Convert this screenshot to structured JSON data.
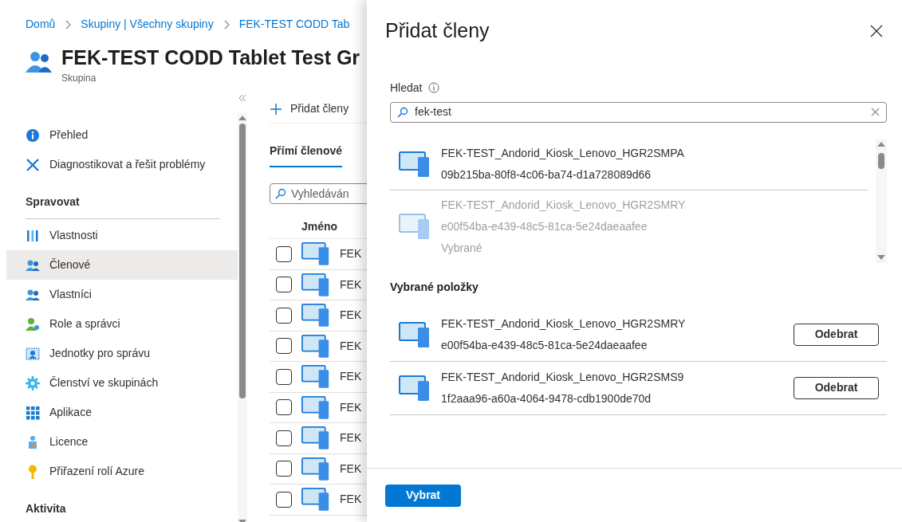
{
  "breadcrumb": [
    {
      "label": "Domů"
    },
    {
      "label": "Skupiny | Všechny skupiny"
    },
    {
      "label": "FEK-TEST CODD Tab"
    }
  ],
  "page": {
    "title": "FEK-TEST CODD Tablet Test Gr",
    "subtitle": "Skupina"
  },
  "sidebar": {
    "items": [
      {
        "kind": "item",
        "label": "Přehled",
        "selected": false
      },
      {
        "kind": "item",
        "label": "Diagnostikovat a řešit problémy",
        "selected": false
      },
      {
        "kind": "heading",
        "label": "Spravovat"
      },
      {
        "kind": "item",
        "label": "Vlastnosti",
        "selected": false
      },
      {
        "kind": "item",
        "label": "Členové",
        "selected": true
      },
      {
        "kind": "item",
        "label": "Vlastníci",
        "selected": false
      },
      {
        "kind": "item",
        "label": "Role a správci",
        "selected": false
      },
      {
        "kind": "item",
        "label": "Jednotky pro správu",
        "selected": false
      },
      {
        "kind": "item",
        "label": "Členství ve skupinách",
        "selected": false
      },
      {
        "kind": "item",
        "label": "Aplikace",
        "selected": false
      },
      {
        "kind": "item",
        "label": "Licence",
        "selected": false
      },
      {
        "kind": "item",
        "label": "Přiřazení rolí Azure",
        "selected": false
      },
      {
        "kind": "heading",
        "label": "Aktivita"
      }
    ]
  },
  "content": {
    "command": "Přidat členy",
    "tab": {
      "label": "Přímí členové",
      "selected": true
    },
    "search": {
      "placeholder": "Vyhledáván"
    },
    "column": "Jméno",
    "rows": [
      {
        "name": "FEK",
        "checked": false
      },
      {
        "name": "FEK",
        "checked": false
      },
      {
        "name": "FEK",
        "checked": false
      },
      {
        "name": "FEK",
        "checked": false
      },
      {
        "name": "FEK",
        "checked": false
      },
      {
        "name": "FEK",
        "checked": false
      },
      {
        "name": "FEK",
        "checked": false
      },
      {
        "name": "FEK",
        "checked": false
      },
      {
        "name": "FEK",
        "checked": false
      }
    ]
  },
  "panel": {
    "title": "Přidat členy",
    "search_label": "Hledat",
    "search": {
      "value": "fek-test"
    },
    "results": [
      {
        "name": "FEK-TEST_Andorid_Kiosk_Lenovo_HGR2SMPA",
        "id": "09b215ba-80f8-4c06-ba74-d1a728089d66",
        "selected": false
      },
      {
        "name": "FEK-TEST_Andorid_Kiosk_Lenovo_HGR2SMRY",
        "id": "e00f54ba-e439-48c5-81ca-5e24daeaafee",
        "selected": true,
        "status": "Vybrané"
      }
    ],
    "selected_heading": "Vybrané položky",
    "selected_items": [
      {
        "name": "FEK-TEST_Andorid_Kiosk_Lenovo_HGR2SMRY",
        "id": "e00f54ba-e439-48c5-81ca-5e24daeaafee",
        "action": "Odebrat"
      },
      {
        "name": "FEK-TEST_Andorid_Kiosk_Lenovo_HGR2SMS9",
        "id": "1f2aaa96-a60a-4064-9478-cdb1900de70d",
        "action": "Odebrat"
      }
    ],
    "primary_button": "Vybrat"
  }
}
